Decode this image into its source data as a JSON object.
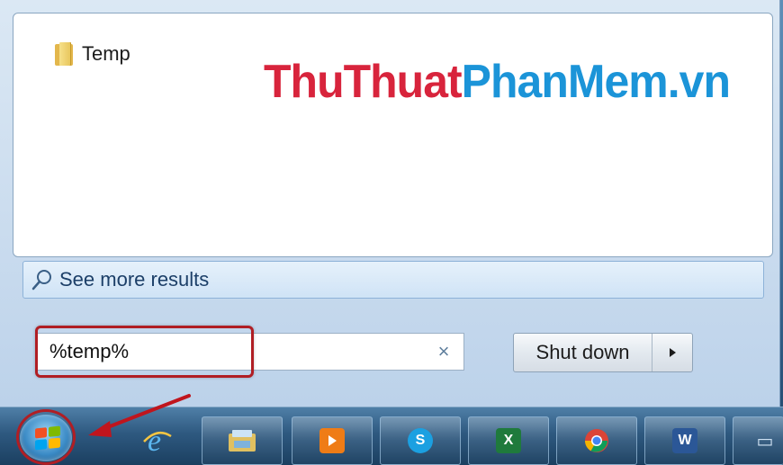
{
  "results": {
    "items": [
      {
        "label": "Temp",
        "icon": "folder-icon"
      }
    ]
  },
  "watermark": {
    "part1": "ThuThuat",
    "part2": "PhanMem.vn",
    "color1": "#d8243c",
    "color2": "#1b94d8"
  },
  "see_more": {
    "label": "See more results",
    "icon": "search-icon"
  },
  "search": {
    "value": "%temp%",
    "clear_label": "×"
  },
  "shutdown": {
    "label": "Shut down",
    "arrow_icon": "triangle-right-icon"
  },
  "highlight_color": "#b01e24",
  "taskbar": {
    "start_icon": "windows-orb-icon",
    "apps": [
      {
        "name": "internet-explorer",
        "icon": "ie-icon"
      },
      {
        "name": "file-explorer",
        "icon": "explorer-icon"
      },
      {
        "name": "media-player",
        "icon": "media-player-icon"
      },
      {
        "name": "skype",
        "icon": "skype-icon",
        "glyph": "S"
      },
      {
        "name": "excel",
        "icon": "excel-icon",
        "glyph": "X"
      },
      {
        "name": "chrome",
        "icon": "chrome-icon"
      },
      {
        "name": "word",
        "icon": "word-icon",
        "glyph": "W"
      },
      {
        "name": "partial-app",
        "icon": "app-icon"
      }
    ]
  }
}
